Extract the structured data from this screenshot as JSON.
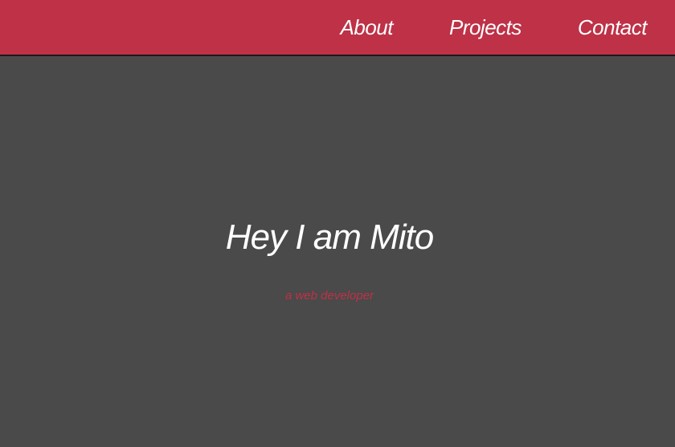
{
  "nav": {
    "links": [
      {
        "label": "About"
      },
      {
        "label": "Projects"
      },
      {
        "label": "Contact"
      }
    ]
  },
  "hero": {
    "title": "Hey I am Mito",
    "subtitle": "a web developer"
  },
  "colors": {
    "accent": "#be3146",
    "background": "#4a4a4a",
    "text": "#ffffff"
  }
}
